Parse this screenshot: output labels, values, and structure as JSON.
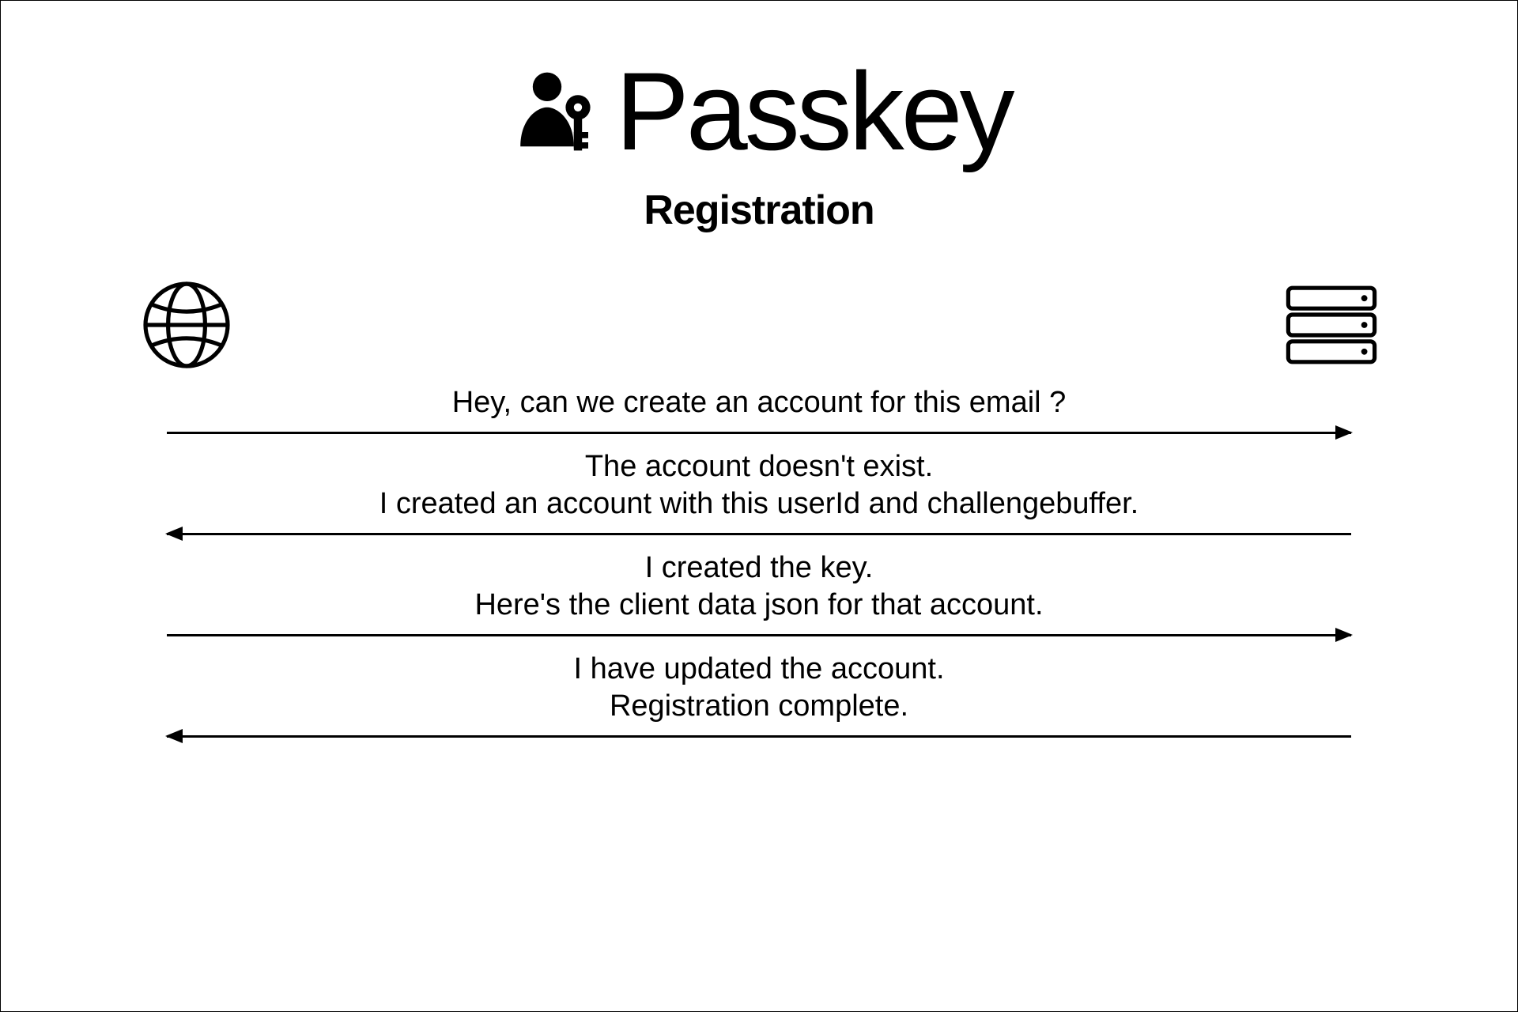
{
  "header": {
    "title": "Passkey",
    "subtitle": "Registration"
  },
  "actors": {
    "left": "browser",
    "right": "server"
  },
  "steps": [
    {
      "direction": "right",
      "lines": [
        "Hey, can we create an account for this email ?"
      ]
    },
    {
      "direction": "left",
      "lines": [
        "The account doesn't exist.",
        "I created an account with this userId and challengebuffer."
      ]
    },
    {
      "direction": "right",
      "lines": [
        "I created the key.",
        "Here's the client data json for that account."
      ]
    },
    {
      "direction": "left",
      "lines": [
        "I have updated the account.",
        "Registration complete."
      ]
    }
  ]
}
